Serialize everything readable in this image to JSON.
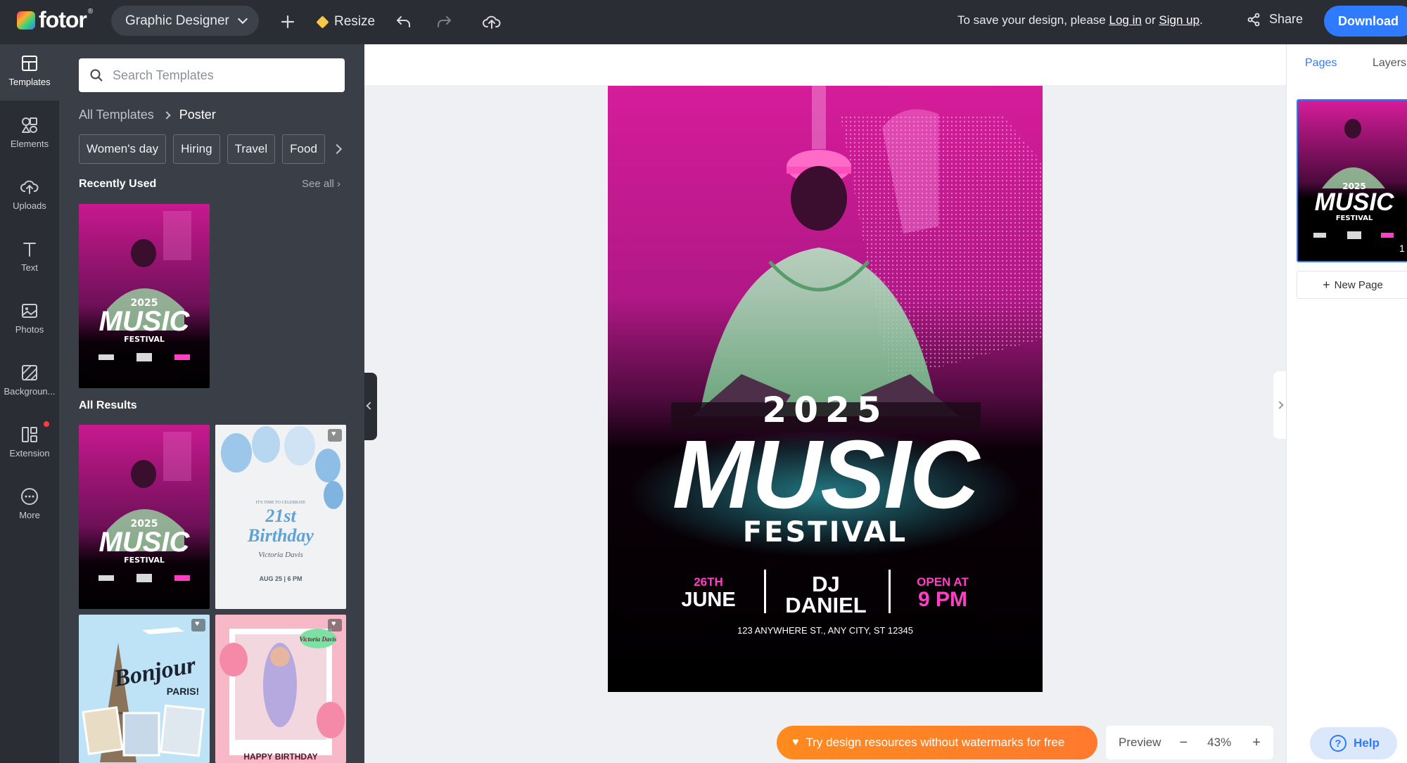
{
  "app": {
    "logo_text": "fotor",
    "logo_reg": "®",
    "role": "Graphic Designer"
  },
  "toolbar": {
    "resize_label": "Resize",
    "save_prefix": "To save your design, please",
    "login_label": "Log in",
    "or_text": "or",
    "signup_label": "Sign up",
    "share_label": "Share",
    "download_label": "Download"
  },
  "rail": {
    "items": [
      {
        "label": "Templates",
        "icon": "templates-icon"
      },
      {
        "label": "Elements",
        "icon": "elements-icon"
      },
      {
        "label": "Uploads",
        "icon": "uploads-icon"
      },
      {
        "label": "Text",
        "icon": "text-icon"
      },
      {
        "label": "Photos",
        "icon": "photos-icon"
      },
      {
        "label": "Backgroun...",
        "icon": "background-icon"
      },
      {
        "label": "Extension",
        "icon": "extension-icon"
      },
      {
        "label": "More",
        "icon": "more-icon"
      }
    ]
  },
  "panel": {
    "search_placeholder": "Search Templates",
    "breadcrumb_root": "All Templates",
    "breadcrumb_current": "Poster",
    "chips": [
      "Women's day",
      "Hiring",
      "Travel",
      "Food"
    ],
    "recent_title": "Recently Used",
    "see_all": "See all",
    "results_title": "All Results"
  },
  "thumbs": {
    "music_year": "2025",
    "music_title": "MUSIC",
    "music_sub": "FESTIVAL",
    "birthday_top": "IT'S TIME TO CELEBRATE",
    "birthday_title_1": "21st",
    "birthday_title_2": "Birthday",
    "birthday_name": "Victoria Davis",
    "birthday_date": "AUG 25 | 6 PM",
    "paris_title": "Bonjour",
    "paris_sub": "PARIS!",
    "party_badge": "Victoria Davis",
    "party_bottom": "HAPPY BIRTHDAY"
  },
  "poster": {
    "year": "2025",
    "title": "MUSIC",
    "subtitle": "FESTIVAL",
    "date_top": "26TH",
    "date_bottom": "JUNE",
    "dj_top": "DJ",
    "dj_bottom": "DANIEL",
    "open_top": "OPEN AT",
    "open_bottom": "9 PM",
    "address": "123 ANYWHERE ST., ANY CITY, ST 12345"
  },
  "rpanel": {
    "tab_pages": "Pages",
    "tab_layers": "Layers",
    "page_number": "1",
    "new_page": "New Page"
  },
  "bottom": {
    "promo": "Try design resources without watermarks for free",
    "preview": "Preview",
    "zoom": "43%",
    "help": "Help"
  },
  "colors": {
    "accent": "#2f7bff",
    "promo": "#ff8a1e",
    "poster_pink": "#ff3fc4"
  }
}
